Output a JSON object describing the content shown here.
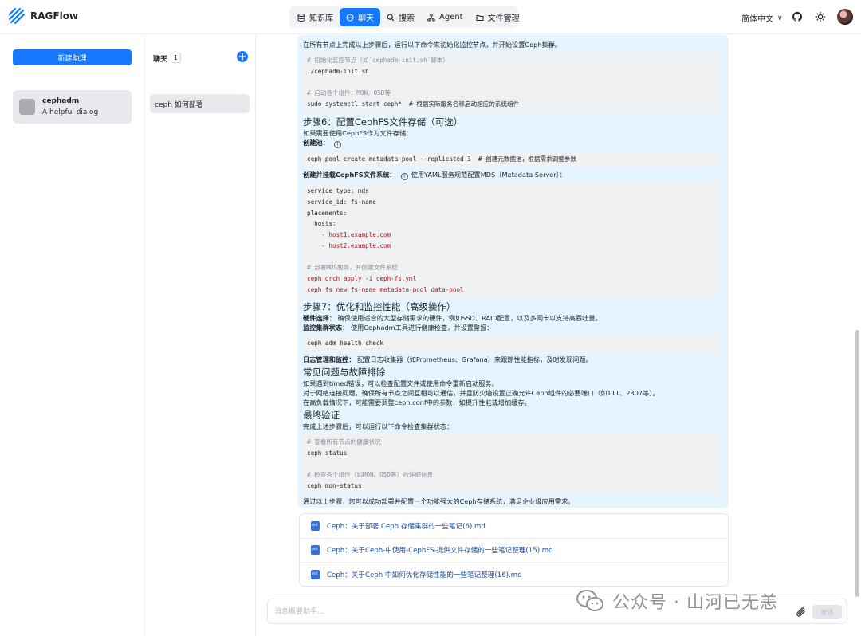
{
  "app": {
    "name": "RAGFlow"
  },
  "nav": [
    {
      "label": "知识库",
      "icon": "database-icon",
      "active": false
    },
    {
      "label": "聊天",
      "icon": "chat-icon",
      "active": true
    },
    {
      "label": "搜索",
      "icon": "search-icon",
      "active": false
    },
    {
      "label": "Agent",
      "icon": "agent-icon",
      "active": false
    },
    {
      "label": "文件管理",
      "icon": "folder-icon",
      "active": false
    }
  ],
  "header": {
    "language": "简体中文"
  },
  "sidebar": {
    "new_button": "新建助理",
    "assistants": [
      {
        "name": "cephadm",
        "description": "A helpful dialog"
      }
    ]
  },
  "conversations": {
    "title": "聊天",
    "count": "1",
    "items": [
      "ceph 如何部署"
    ]
  },
  "message": {
    "line_intro": "在所有节点上完成以上步骤后，运行以下命令来初始化监控节点，并开始设置Ceph集群。",
    "code1": [
      "# 初始化监控节点（如`cephadm-init.sh`脚本）",
      "./cephadm-init.sh",
      "",
      "# 启动各个组件：MON、OSD等",
      "sudo systemctl start ceph*  # 根据实际服务名称启动相应的系统组件"
    ],
    "step6_title": "步骤6：配置CephFS文件存储（可选）",
    "step6_intro": "如果需要使用CephFS作为文件存储：",
    "create_pool_label": "创建池：",
    "code2": "ceph pool create metadata-pool --replicated 3  # 创建元数据池，根据需求调整参数",
    "mount_label": "创建并挂载CephFS文件系统：",
    "mount_desc": "使用YAML服务规范配置MDS（Metadata Server）：",
    "code3": [
      "service_type: mds",
      "service_id: fs-name",
      "placements:",
      "  hosts:",
      "    - host1.example.com",
      "    - host2.example.com",
      "",
      "# 部署MDS服务，并创建文件系统",
      "ceph orch apply -i ceph-fs.yml",
      "ceph fs new fs-name metadata-pool data-pool"
    ],
    "step7_title": "步骤7：优化和监控性能（高级操作）",
    "hw_label": "硬件选择：",
    "hw_desc": "确保使用适合的大型存储需求的硬件，例如SSD、RAID配置，以及多网卡以支持高吞吐量。",
    "monitor_label": "监控集群状态：",
    "monitor_desc": "使用Cephadm工具进行健康检查，并设置警报：",
    "code4": "ceph adm health check",
    "log_label": "日志管理和监控：",
    "log_desc": "配置日志收集器（如Prometheus、Grafana）来跟踪性能指标，及时发现问题。",
    "faq_title": "常见问题与故障排除",
    "faq_lines": [
      "如果遇到timed错误，可以检查配置文件或使用命令重新启动服务。",
      "对于网络连接问题，确保所有节点之间互相可以通信，并且防火墙设置正确允许Ceph组件的必要端口（如111、2307等）。",
      "在高负载情况下，可能需要调整ceph.conf中的参数，如提升性能或增加缓存。"
    ],
    "verify_title": "最终验证",
    "verify_intro": "完成上述步骤后，可以运行以下命令检查集群状态：",
    "code5": [
      "# 查看所有节点的健康状况",
      "ceph status",
      "",
      "# 检查各个组件（如MON、OSD等）的详细信息",
      "ceph mon-status"
    ],
    "conclusion": "通过以上步骤，您可以成功部署并配置一个功能强大的Ceph存储系统，满足企业级应用需求。"
  },
  "references": [
    "Ceph：关于部署 Ceph 存储集群的一些笔记(6).md",
    "Ceph：关于Ceph-中使用-CephFS-提供文件存储的一些笔记整理(15).md",
    "Ceph：关于Ceph 中如何优化存储性能的一些笔记整理(16).md"
  ],
  "input": {
    "placeholder": "消息概要助手...",
    "send_label": "发送"
  },
  "watermark": "公众号 · 山河已无恙",
  "colors": {
    "accent": "#1677ff",
    "bubble": "#e6f4ff"
  }
}
